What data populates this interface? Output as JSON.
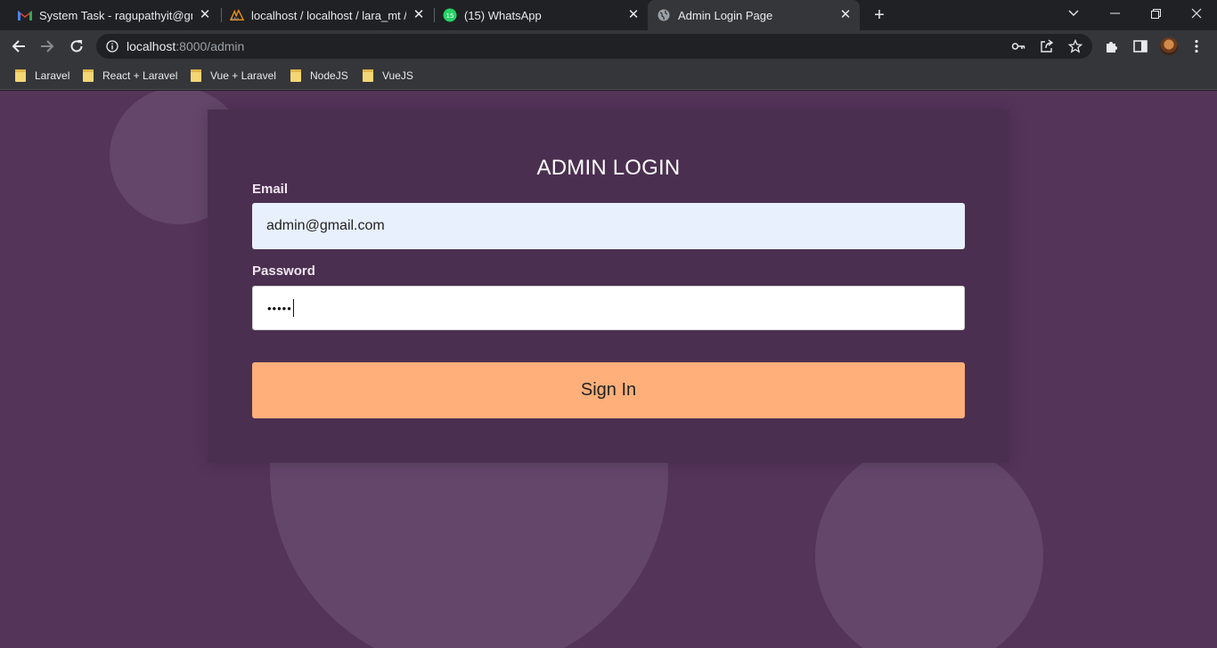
{
  "browser": {
    "tabs": [
      {
        "title": "System Task - ragupathyit@gmail",
        "favicon": "gmail-icon",
        "active": false
      },
      {
        "title": "localhost / localhost / lara_mt / c",
        "favicon": "phpmyadmin-icon",
        "active": false
      },
      {
        "title": "(15) WhatsApp",
        "favicon": "whatsapp-icon",
        "badge": "15",
        "active": false
      },
      {
        "title": "Admin Login Page",
        "favicon": "globe-icon",
        "active": true
      }
    ],
    "address_bar": {
      "host": "localhost",
      "path": ":8000/admin"
    },
    "bookmarks": [
      "Laravel",
      "React + Laravel",
      "Vue + Laravel",
      "NodeJS",
      "VueJS"
    ]
  },
  "login": {
    "title": "ADMIN LOGIN",
    "email_label": "Email",
    "email_value": "admin@gmail.com",
    "password_label": "Password",
    "password_value": "•••••",
    "submit_label": "Sign In"
  },
  "colors": {
    "page_background": "#55345a",
    "card_background": "#4b2f50",
    "button_background": "#ffaf7a",
    "email_field_background": "#e8f0fe"
  }
}
